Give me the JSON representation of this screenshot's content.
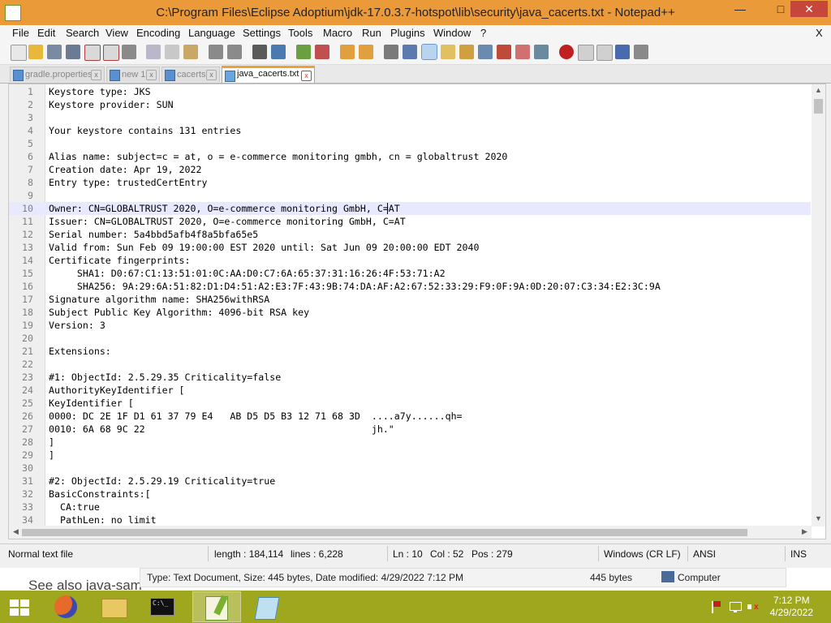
{
  "window": {
    "title": "C:\\Program Files\\Eclipse Adoptium\\jdk-17.0.3.7-hotspot\\lib\\security\\java_cacerts.txt - Notepad++"
  },
  "window_controls": {
    "minimize": "—",
    "maximize": "□",
    "close": "✕"
  },
  "menu": {
    "items": [
      "File",
      "Edit",
      "Search",
      "View",
      "Encoding",
      "Language",
      "Settings",
      "Tools",
      "Macro",
      "Run",
      "Plugins",
      "Window",
      "?"
    ],
    "close_label": "X"
  },
  "toolbar": {
    "icons": [
      "new-file-icon",
      "open-file-icon",
      "save-icon",
      "save-all-icon",
      "close-icon",
      "close-all-icon",
      "print-icon",
      "cut-icon",
      "copy-icon",
      "paste-icon",
      "undo-icon",
      "redo-icon",
      "find-icon",
      "replace-icon",
      "zoom-in-icon",
      "zoom-out-icon",
      "sync-vertical-icon",
      "sync-horizontal-icon",
      "word-wrap-icon",
      "show-all-characters-icon",
      "indent-guide-icon",
      "user-defined-language-icon",
      "document-map-icon",
      "document-list-icon",
      "function-list-icon",
      "folder-as-workspace-icon",
      "monitoring-icon",
      "record-macro-icon",
      "stop-recording-icon",
      "play-macro-icon",
      "run-macro-multiple-icon",
      "save-macro-icon"
    ],
    "selected_icon": "indent-guide-icon"
  },
  "tabs": [
    {
      "label": "gradle.properties",
      "active": false
    },
    {
      "label": "new 1",
      "active": false
    },
    {
      "label": "cacerts",
      "active": false
    },
    {
      "label": "java_cacerts.txt",
      "active": true
    }
  ],
  "editor": {
    "current_line": 10,
    "lines": [
      "Keystore type: JKS",
      "Keystore provider: SUN",
      "",
      "Your keystore contains 131 entries",
      "",
      "Alias name: subject=c = at, o = e-commerce monitoring gmbh, cn = globaltrust 2020",
      "Creation date: Apr 19, 2022",
      "Entry type: trustedCertEntry",
      "",
      "Owner: CN=GLOBALTRUST 2020, O=e-commerce monitoring GmbH, C=AT",
      "Issuer: CN=GLOBALTRUST 2020, O=e-commerce monitoring GmbH, C=AT",
      "Serial number: 5a4bbd5afb4f8a5bfa65e5",
      "Valid from: Sun Feb 09 19:00:00 EST 2020 until: Sat Jun 09 20:00:00 EDT 2040",
      "Certificate fingerprints:",
      "     SHA1: D0:67:C1:13:51:01:0C:AA:D0:C7:6A:65:37:31:16:26:4F:53:71:A2",
      "     SHA256: 9A:29:6A:51:82:D1:D4:51:A2:E3:7F:43:9B:74:DA:AF:A2:67:52:33:29:F9:0F:9A:0D:20:07:C3:34:E2:3C:9A",
      "Signature algorithm name: SHA256withRSA",
      "Subject Public Key Algorithm: 4096-bit RSA key",
      "Version: 3",
      "",
      "Extensions:",
      "",
      "#1: ObjectId: 2.5.29.35 Criticality=false",
      "AuthorityKeyIdentifier [",
      "KeyIdentifier [",
      "0000: DC 2E 1F D1 61 37 79 E4   AB D5 D5 B3 12 71 68 3D  ....a7y......qh=",
      "0010: 6A 68 9C 22                                        jh.\"",
      "]",
      "]",
      "",
      "#2: ObjectId: 2.5.29.19 Criticality=true",
      "BasicConstraints:[",
      "  CA:true",
      "  PathLen: no limit"
    ]
  },
  "scrollbar": {
    "up": "▲",
    "down": "▼",
    "left": "◀",
    "right": "▶"
  },
  "status": {
    "file_type": "Normal text file",
    "length": "length : 184,114",
    "lines": "lines : 6,228",
    "ln": "Ln : 10",
    "col": "Col : 52",
    "pos": "Pos : 279",
    "eol": "Windows (CR LF)",
    "encoding": "ANSI",
    "mode": "INS"
  },
  "explorer": {
    "see_also": "See also java-sam",
    "file_info": "Type: Text Document, Size: 445 bytes, Date modified: 4/29/2022 7:12 PM",
    "size": "445 bytes",
    "location": "Computer"
  },
  "taskbar": {
    "apps": [
      "windows-start-icon",
      "firefox-icon",
      "file-explorer-icon",
      "command-prompt-icon",
      "notepad-plus-plus-icon",
      "notepad-icon"
    ],
    "cmd_label": "C:\\_",
    "time": "7:12 PM",
    "date": "4/29/2022"
  }
}
